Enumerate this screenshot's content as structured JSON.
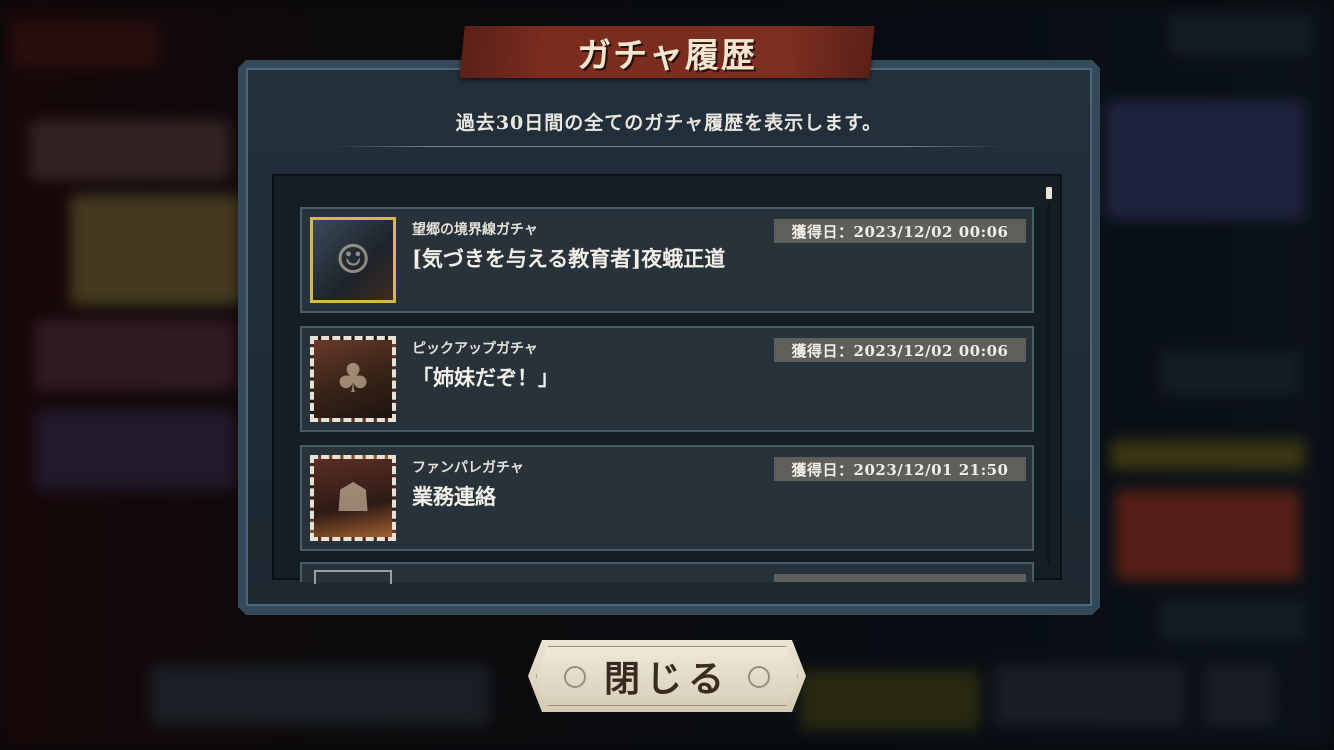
{
  "dialog": {
    "title": "ガチャ履歴",
    "subtitle": "過去30日間の全てのガチャ履歴を表示します。",
    "close_label": "閉じる"
  },
  "entries": [
    {
      "gacha_name": "望郷の境界線ガチャ",
      "item_name": "[気づきを与える教育者]夜蛾正道",
      "date": "獲得日：2023/12/02 00:06",
      "thumb_style": "gold",
      "thumb_icon": "character-portrait-icon"
    },
    {
      "gacha_name": "ピックアップガチャ",
      "item_name": "「姉妹だぞ！」",
      "date": "獲得日：2023/12/02 00:06",
      "thumb_style": "film",
      "thumb_icon": "scene-card-icon"
    },
    {
      "gacha_name": "ファンパレガチャ",
      "item_name": "業務連絡",
      "date": "獲得日：2023/12/01 21:50",
      "thumb_style": "film2",
      "thumb_icon": "scene-card-icon"
    }
  ],
  "colors": {
    "ribbon": "#7a2c1f",
    "panel": "#22303b",
    "entry_bg": "#27323b",
    "date_badge": "#5e5e5a",
    "gold_frame": "#d9b84a"
  }
}
